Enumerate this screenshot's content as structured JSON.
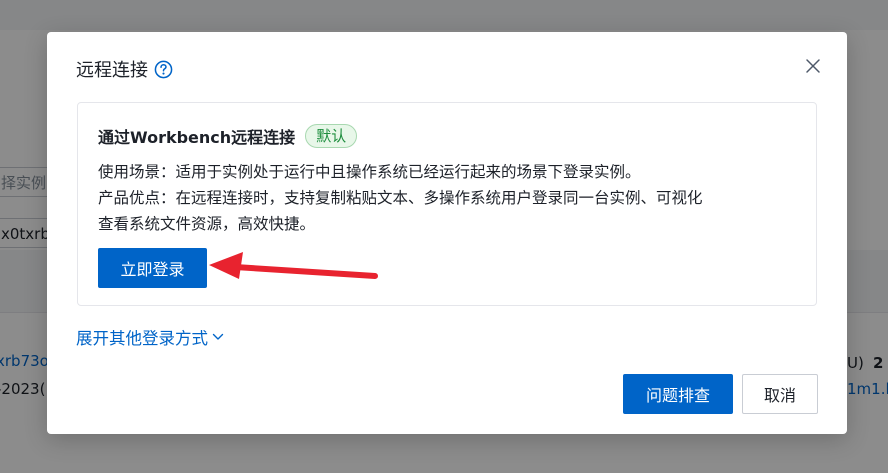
{
  "background": {
    "search_placeholder_fragment": "择实例",
    "instance_fragment": "x0txrb",
    "row_link_fragment": "xrb73o",
    "row_date_fragment": "-2023(",
    "right_text_fragment": "U)",
    "right_count": "2",
    "right_link_fragment": "1m1.l"
  },
  "dialog": {
    "title": "远程连接",
    "card": {
      "title": "通过Workbench远程连接",
      "badge": "默认",
      "line1": "使用场景：适用于实例处于运行中且操作系统已经运行起来的场景下登录实例。",
      "line2": "产品优点：在远程连接时，支持复制粘贴文本、多操作系统用户登录同一台实例、可视化",
      "line3": "查看系统文件资源，高效快捷。",
      "login_button": "立即登录"
    },
    "expand_link": "展开其他登录方式",
    "troubleshoot_button": "问题排查",
    "cancel_button": "取消"
  },
  "colors": {
    "primary": "#0064c8",
    "badge_green": "#1e8e3e",
    "annotation_arrow": "#e8232f"
  }
}
